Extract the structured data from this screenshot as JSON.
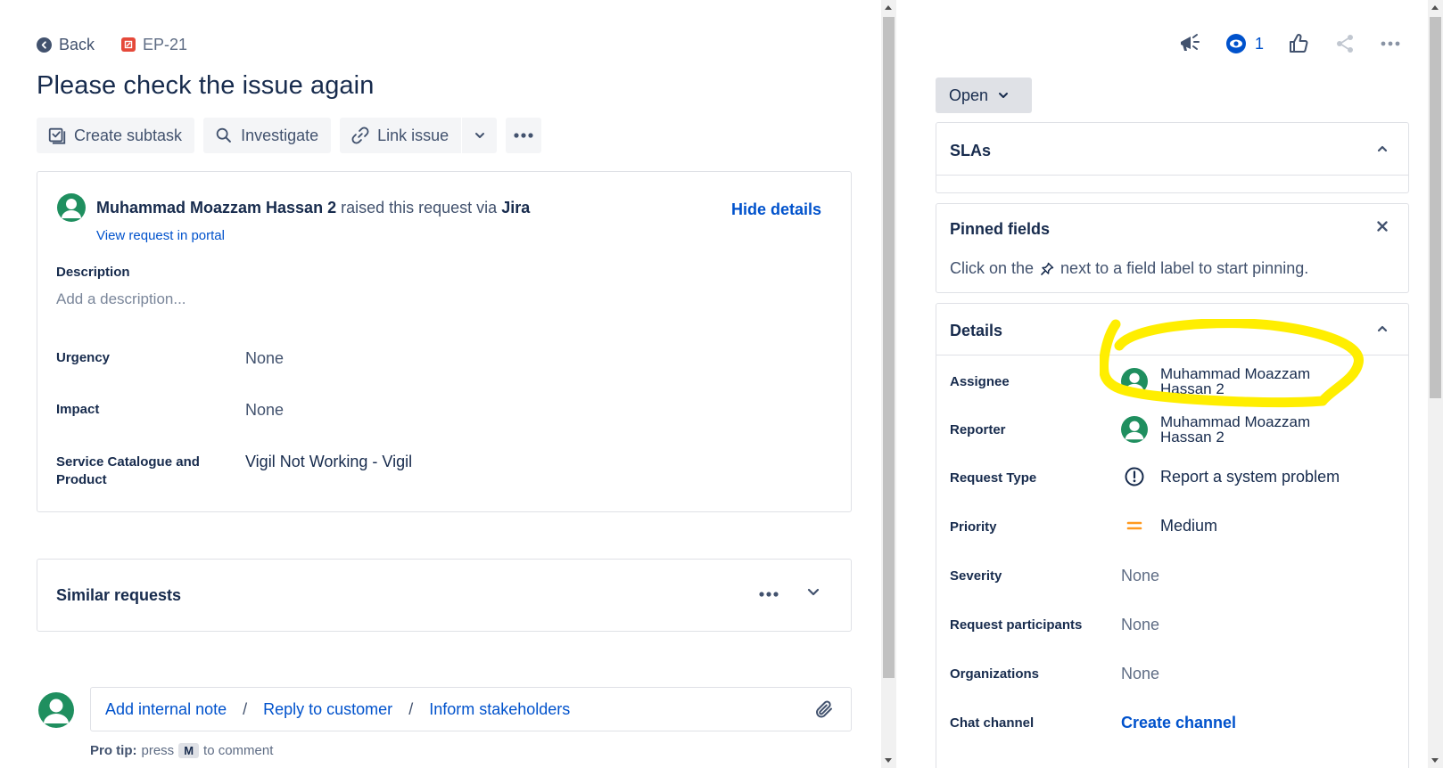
{
  "breadcrumb": {
    "back_label": "Back",
    "issue_key": "EP-21"
  },
  "issue": {
    "title": "Please check the issue again"
  },
  "toolbar": {
    "create_subtask": "Create subtask",
    "investigate": "Investigate",
    "link_issue": "Link issue"
  },
  "request": {
    "requester_name": "Muhammad Moazzam Hassan 2",
    "raised_text": "raised this request via",
    "source": "Jira",
    "view_portal": "View request in portal",
    "hide_details": "Hide details",
    "description_label": "Description",
    "description_placeholder": "Add a description...",
    "fields": [
      {
        "label": "Urgency",
        "value": "None"
      },
      {
        "label": "Impact",
        "value": "None"
      },
      {
        "label_line1": "Service Catalogue and",
        "label_line2": "Product",
        "value": "Vigil Not Working - Vigil"
      }
    ]
  },
  "similar": {
    "label": "Similar requests"
  },
  "comment": {
    "add_internal_note": "Add internal note",
    "reply_to_customer": "Reply to customer",
    "inform_stakeholders": "Inform stakeholders",
    "separator": "/",
    "protip_label": "Pro tip:",
    "protip_press": "press",
    "protip_key": "M",
    "protip_suffix": "to comment"
  },
  "header_actions": {
    "watchers_count": "1"
  },
  "status": {
    "label": "Open"
  },
  "slas": {
    "title": "SLAs"
  },
  "pinned": {
    "title": "Pinned fields",
    "text_before": "Click on the",
    "text_after": "next to a field label to start pinning."
  },
  "details": {
    "title": "Details",
    "assignee": {
      "label": "Assignee",
      "line1": "Muhammad Moazzam",
      "line2": "Hassan 2"
    },
    "reporter": {
      "label": "Reporter",
      "line1": "Muhammad Moazzam",
      "line2": "Hassan 2"
    },
    "request_type": {
      "label": "Request Type",
      "value": "Report a system problem"
    },
    "priority": {
      "label": "Priority",
      "value": "Medium"
    },
    "severity": {
      "label": "Severity",
      "value": "None"
    },
    "request_participants": {
      "label": "Request participants",
      "value": "None"
    },
    "organizations": {
      "label": "Organizations",
      "value": "None"
    },
    "chat_channel": {
      "label": "Chat channel",
      "value": "Create channel"
    }
  },
  "colors": {
    "link_blue": "#0052cc",
    "avatar_green": "#1f8f5f",
    "priority_orange": "#ff991f",
    "highlight_yellow": "#ffee00"
  }
}
